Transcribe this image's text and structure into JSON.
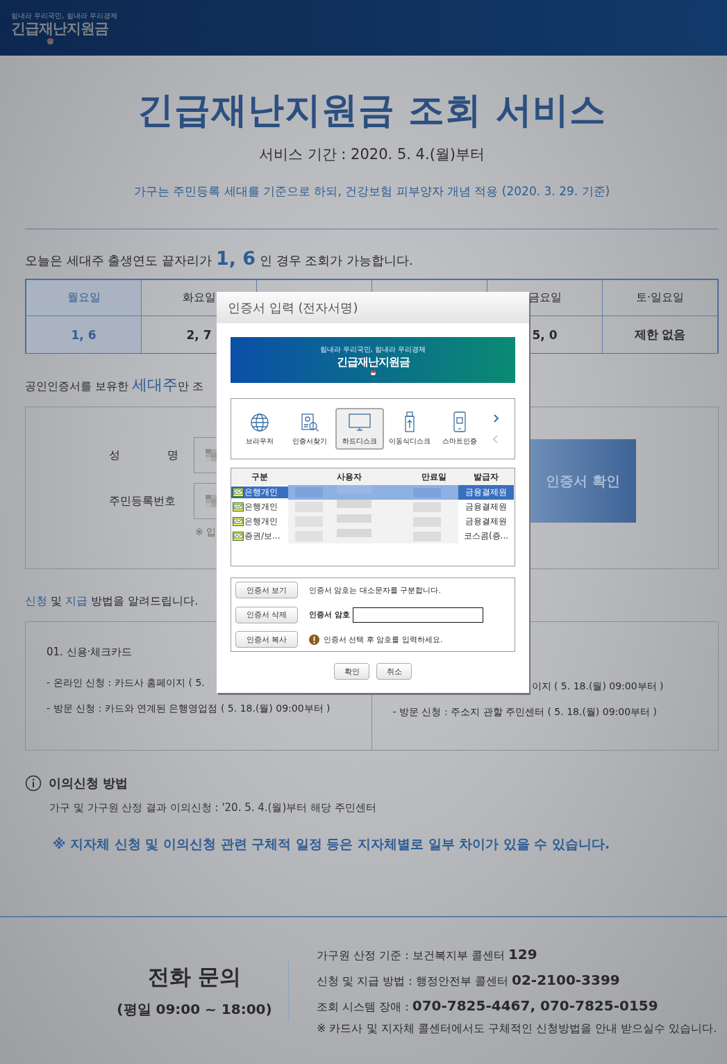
{
  "header": {
    "slogan": "힘내라 우리국민, 힘내라 우리경제",
    "logo": "긴급재난지원금"
  },
  "title": "긴급재난지원금 조회 서비스",
  "period": "서비스 기간 : 2020. 5. 4.(월)부터",
  "notice": "가구는 주민등록 세대를 기준으로 하되, 건강보험 피부양자 개념 적용 (2020. 3. 29. 기준)",
  "today": "오늘은 세대주 출생연도 끝자리가 **1, 6** 인 경우 조회가 가능합니다.",
  "days": [
    {
      "label": "월요일",
      "digits": "1, 6",
      "selected": true
    },
    {
      "label": "화요일",
      "digits": "2, 7",
      "selected": false
    },
    {
      "selected": false
    },
    {
      "selected": false
    },
    {
      "label": "금요일",
      "digits": "5, 0",
      "selected": false
    },
    {
      "label": "토·일요일",
      "digits": "제한 없음",
      "selected": false
    }
  ],
  "certificate_note": "공인인증서를 보유한 **세대주**만 조",
  "form": {
    "fields": [
      {
        "label": "성 명"
      },
      {
        "label": "주민등록번호"
      }
    ],
    "hint": "※ 입",
    "button": "인증서 확인"
  },
  "methods": {
    "heading": "**신청** 및 **지급** 방법을 알려드립니다.",
    "left": {
      "title": "01. 신용·체크카드",
      "lines": [
        "- 온라인 신청 : 카드사 홈페이지 ( 5.",
        "- 방문 신청 : 카드와 연계된 은행영업점 ( 5. 18.(월) 09:00부터 )"
      ]
    },
    "right": {
      "lines": [
        "이지 ( 5. 18.(월) 09:00부터 )",
        "- 방문 신청 : 주소지 관할 주민센터 ( 5. 18.(월) 09:00부터 )"
      ]
    }
  },
  "objection": {
    "title": "이의신청 방법",
    "text": "가구 및 가구원 산정 결과 이의신청 : '20. 5. 4.(월)부터 해당 주민센터"
  },
  "schedule_note": "※ 지자체 신청 및 이의신청 관련 구체적 일정 등은 지자체별로 일부 차이가 있을 수 있습니다.",
  "footer": {
    "title": "전화 문의",
    "hours": "(평일 09:00 ~ 18:00)",
    "lines": [
      "가구원 산정 기준 : 보건복지부 콜센터 **129**",
      "신청 및 지급 방법 : 행정안전부 콜센터 **02-2100-3399**",
      "조회 시스템 장애 : **070-7825-4467, 070-7825-0159**"
    ],
    "note": "※ 카드사 및 지자체 콜센터에서도 구체적인 신청방법을 안내 받으실수 있습니다."
  },
  "dialog": {
    "title": "인증서 입력 (전자서명)",
    "banner": {
      "slogan": "힘내라 우리국민, 힘내라 우리경제",
      "logo": "긴급재난지원금"
    },
    "locations": [
      {
        "label": "브라우저",
        "kind": "globe",
        "selected": false
      },
      {
        "label": "인증서찾기",
        "kind": "find",
        "selected": false
      },
      {
        "label": "하드디스크",
        "kind": "monitor",
        "selected": true
      },
      {
        "label": "이동식디스크",
        "kind": "usb",
        "selected": false
      },
      {
        "label": "스마트인증",
        "kind": "phone",
        "selected": false
      }
    ],
    "columns": [
      "구분",
      "사용자",
      "만료일",
      "발급자"
    ],
    "certificates": [
      {
        "type": "은행개인",
        "issuer": "금융결제원",
        "selected": true
      },
      {
        "type": "은행개인",
        "issuer": "금융결제원",
        "selected": false
      },
      {
        "type": "은행개인",
        "issuer": "금융결제원",
        "selected": false
      },
      {
        "type": "증권/보...",
        "issuer": "코스콤(증...",
        "selected": false
      }
    ],
    "actions": [
      "인증서 보기",
      "인증서 삭제",
      "인증서 복사"
    ],
    "case_note": "인증서 암호는 대소문자를 구분합니다.",
    "password_label": "인증서 암호",
    "warning": "인증서 선택 후 암호를 입력하세요.",
    "buttons": [
      "확인",
      "취소"
    ]
  }
}
